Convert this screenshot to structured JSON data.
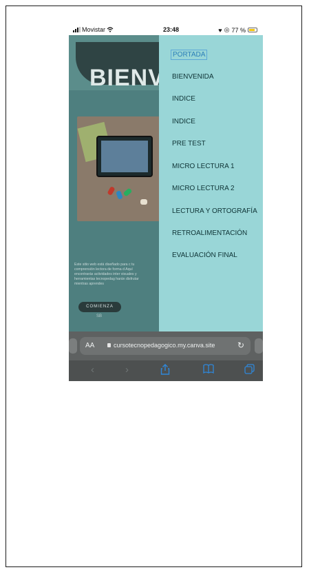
{
  "status_bar": {
    "carrier": "Movistar",
    "time": "23:48",
    "battery": "77 %"
  },
  "site": {
    "hero_title": "BIENV",
    "description": "Este sitio web está diseñado para c tu comprensión lectora de forma d Aquí encontrarás actividades inter visuales y herramientas tecnopedag harán disfrutar mientras aprendes",
    "cta_label": "COMIENZA",
    "cta_sub": "SB"
  },
  "menu": {
    "items": [
      {
        "label": "PORTADA",
        "active": true
      },
      {
        "label": "BIENVENIDA"
      },
      {
        "label": "INDICE"
      },
      {
        "label": "INDICE"
      },
      {
        "label": "PRE TEST"
      },
      {
        "label": "MICRO LECTURA 1"
      },
      {
        "label": "MICRO LECTURA 2"
      },
      {
        "label": "LECTURA Y ORTOGRAFÍA"
      },
      {
        "label": "RETROALIMENTACIÓN"
      },
      {
        "label": "EVALUACIÓN FINAL"
      }
    ]
  },
  "browser": {
    "text_size_label": "AA",
    "url": "cursotecnopedagogico.my.canva.site"
  },
  "icons": {
    "wifi": "wifi-icon",
    "reload": "reload-icon",
    "back": "back-icon",
    "forward": "forward-icon",
    "share": "share-icon",
    "bookmarks": "bookmarks-icon",
    "tabs": "tabs-icon"
  },
  "colors": {
    "menu_background": "#99d6d7",
    "active_item": "#2c7fb8",
    "toolbar_active": "#2f87d9"
  }
}
